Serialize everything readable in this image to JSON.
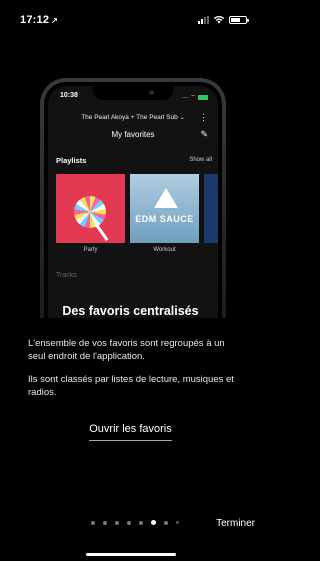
{
  "status_bar": {
    "time": "17:12",
    "location_glyph": "↗"
  },
  "phone_preview": {
    "time": "10:38",
    "speaker_group": "The Pearl Akoya + The Pearl Sub",
    "title": "My favorites",
    "playlists_heading": "Playlists",
    "show_all": "Show all",
    "cards": [
      {
        "caption": "Party"
      },
      {
        "caption": "Workout",
        "art_text": "EDM SAUCE"
      }
    ],
    "tracks_heading": "Tracks"
  },
  "content": {
    "heading": "Des favoris centralisés",
    "paragraph1": "L'ensemble de vos favoris sont regroupés à un seul endroit de l'application.",
    "paragraph2": "Ils sont classés par listes de lecture, musiques et radios.",
    "cta": "Ouvrir les favoris"
  },
  "pager": {
    "total": 8,
    "active_index": 5
  },
  "finish_label": "Terminer",
  "colors": {
    "background": "#000000",
    "battery_green": "#34c759"
  }
}
